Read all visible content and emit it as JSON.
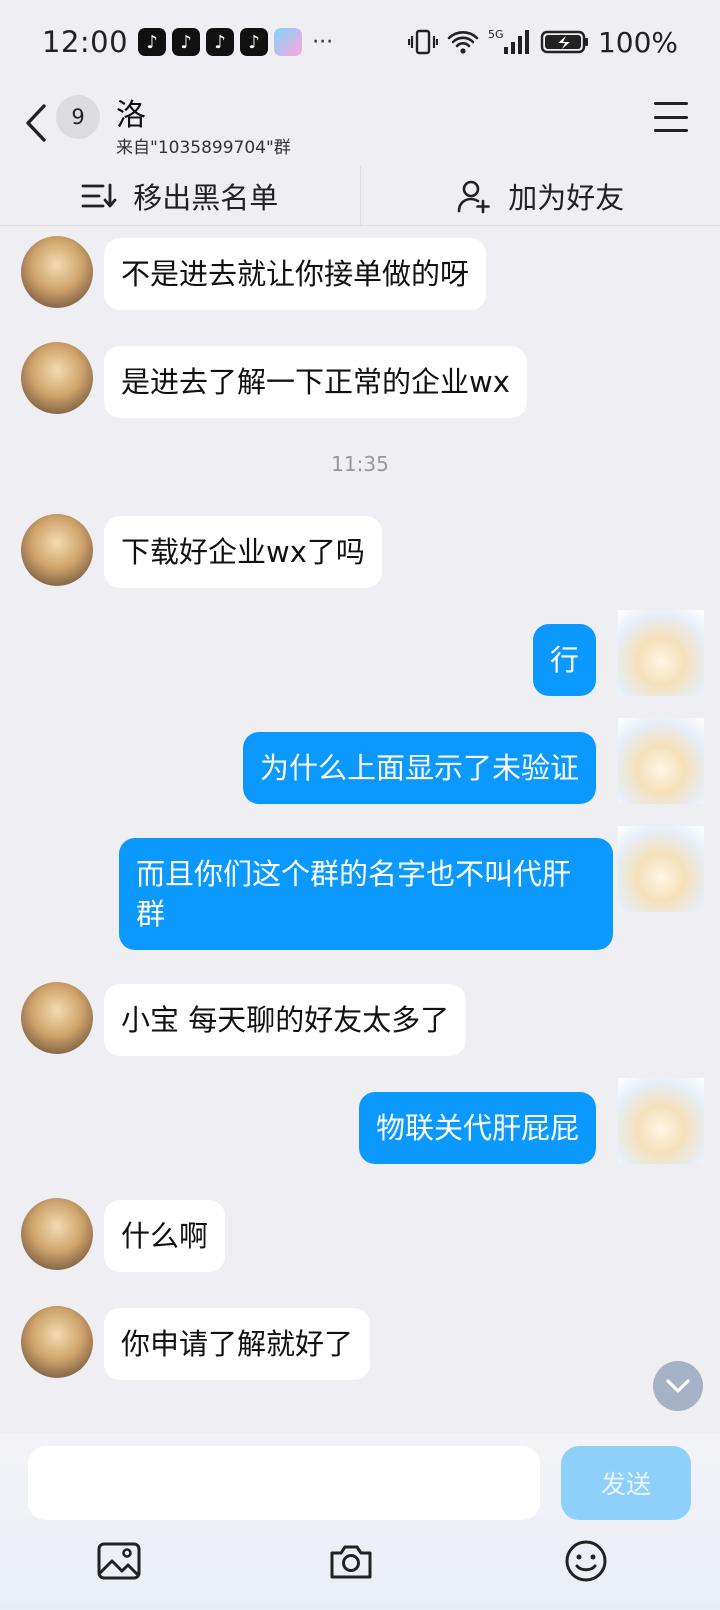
{
  "status_bar": {
    "time": "12:00",
    "notifications": [
      "tiktok-icon",
      "tiktok-icon",
      "tiktok-icon",
      "tiktok-icon",
      "game-icon"
    ],
    "more": "···",
    "network": "5G",
    "battery": "100%"
  },
  "header": {
    "back_icon": "chevron-left-icon",
    "unread_count": "9",
    "name": "洛",
    "source": "来自\"1035899704\"群",
    "menu_icon": "hamburger-menu-icon"
  },
  "actions": {
    "remove_blacklist": "移出黑名单",
    "add_friend": "加为好友"
  },
  "messages": [
    {
      "side": "in",
      "text": "不是进去就让你接单做的呀"
    },
    {
      "side": "in",
      "text": "是进去了解一下正常的企业wx"
    },
    {
      "side": "time",
      "text": "11:35"
    },
    {
      "side": "in",
      "text": "下载好企业wx了吗"
    },
    {
      "side": "out",
      "text": "行"
    },
    {
      "side": "out",
      "text": "为什么上面显示了未验证"
    },
    {
      "side": "out",
      "text": "而且你们这个群的名字也不叫代肝群"
    },
    {
      "side": "in",
      "text": "小宝 每天聊的好友太多了"
    },
    {
      "side": "out",
      "text": "物联关代肝屁屁"
    },
    {
      "side": "in",
      "text": "什么啊"
    },
    {
      "side": "in",
      "text": "你申请了解就好了"
    }
  ],
  "input": {
    "value": "",
    "send_label": "发送"
  },
  "toolbar": [
    "image-icon",
    "camera-icon",
    "emoji-icon"
  ],
  "colors": {
    "outgoing_bubble": "#0b99ff",
    "incoming_bubble": "#ffffff",
    "background": "#eeeef3",
    "send_disabled": "#8fd0fb"
  }
}
